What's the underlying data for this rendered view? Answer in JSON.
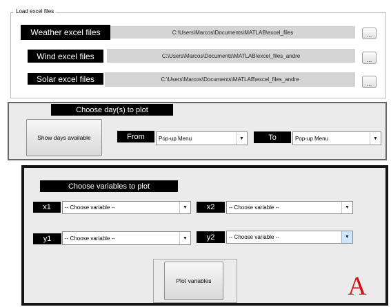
{
  "load_panel": {
    "legend": "Load excel files",
    "rows": [
      {
        "label": "Weather excel files",
        "path": "C:\\Users\\Marcos\\Documents\\MATLAB\\excel_files",
        "browse": "..."
      },
      {
        "label": "Wind excel files",
        "path": "C:\\Users\\Marcos\\Documents\\MATLAB\\excel_files_andre",
        "browse": "..."
      },
      {
        "label": "Solar excel files",
        "path": "C:\\Users\\Marcos\\Documents\\MATLAB\\excel_files_andre",
        "browse": "..."
      }
    ]
  },
  "days_panel": {
    "title": "Choose day(s) to plot",
    "show_days_button": "Show days available",
    "from_label": "From",
    "from_value": "Pop-up Menu",
    "to_label": "To",
    "to_value": "Pop-up Menu"
  },
  "vars_panel": {
    "title": "Choose variables to plot",
    "x1_label": "x1",
    "x1_value": "-- Choose variable --",
    "x2_label": "x2",
    "x2_value": "-- Choose variable --",
    "y1_label": "y1",
    "y1_value": "-- Choose variable --",
    "y2_label": "y2",
    "y2_value": "-- Choose variable --",
    "plot_button": "Plot variables",
    "corner_letter": "A"
  },
  "icons": {
    "dropdown_arrow": "▼"
  },
  "colors": {
    "label_bg": "#000000",
    "path_bg": "#d4d4d4",
    "panel_bg": "#ebebeb",
    "corner_letter": "#cc1111"
  }
}
